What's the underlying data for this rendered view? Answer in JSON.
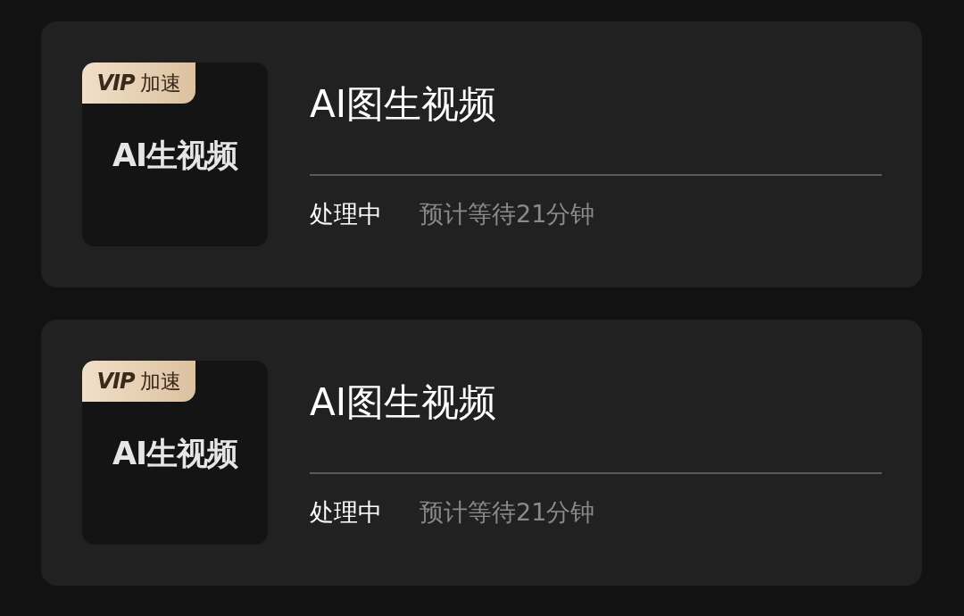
{
  "tasks": [
    {
      "thumbnail": {
        "badge": {
          "logo": "VIP",
          "label": "加速"
        },
        "caption": "AI生视频"
      },
      "title": "AI图生视频",
      "status": "处理中",
      "eta": "预计等待21分钟"
    },
    {
      "thumbnail": {
        "badge": {
          "logo": "VIP",
          "label": "加速"
        },
        "caption": "AI生视频"
      },
      "title": "AI图生视频",
      "status": "处理中",
      "eta": "预计等待21分钟"
    }
  ]
}
